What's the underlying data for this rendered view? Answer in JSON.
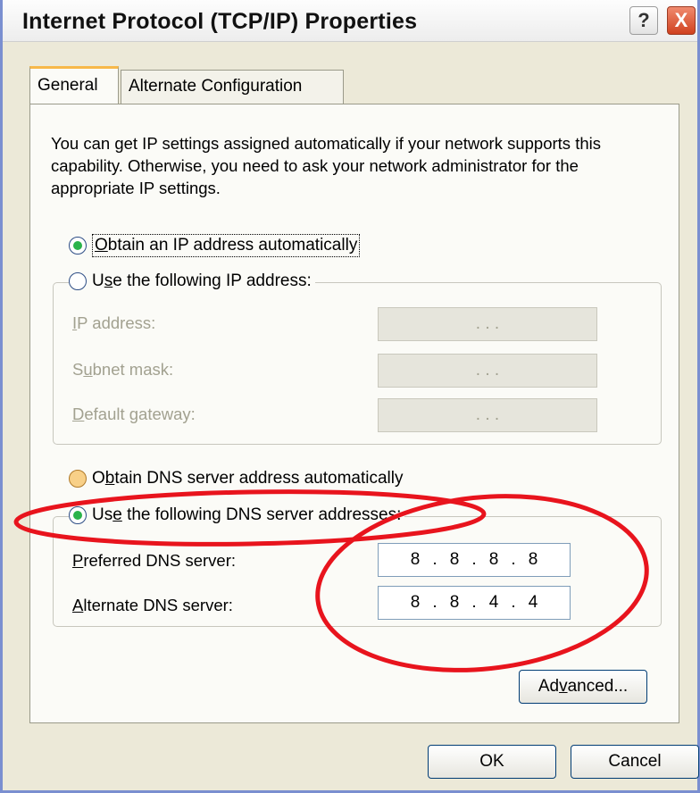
{
  "window": {
    "title": "Internet Protocol (TCP/IP) Properties",
    "help_glyph": "?",
    "close_glyph": "X"
  },
  "tabs": [
    {
      "label": "General",
      "selected": true
    },
    {
      "label": "Alternate Configuration",
      "selected": false
    }
  ],
  "intro_text": "You can get IP settings assigned automatically if your network supports this capability. Otherwise, you need to ask your network administrator for the appropriate IP settings.",
  "ip_section": {
    "auto_option": {
      "pre": "",
      "key": "O",
      "post": "btain an IP address automatically",
      "checked": true
    },
    "manual_option": {
      "pre": "U",
      "key": "s",
      "post": "e the following IP address:",
      "checked": false
    },
    "fields": [
      {
        "pre": "",
        "key": "I",
        "post": "P address:",
        "value": ". . ."
      },
      {
        "pre": "S",
        "key": "u",
        "post": "bnet mask:",
        "value": ". . ."
      },
      {
        "pre": "",
        "key": "D",
        "post": "efault gateway:",
        "value": ". . ."
      }
    ]
  },
  "dns_section": {
    "auto_option": {
      "pre": "O",
      "key": "b",
      "post": "tain DNS server address automatically",
      "checked": false
    },
    "manual_option": {
      "pre": "Us",
      "key": "e",
      "post": " the following DNS server addresses:",
      "checked": true
    },
    "preferred": {
      "pre": "",
      "key": "P",
      "post": "referred DNS server:",
      "octets": [
        "8",
        "8",
        "8",
        "8"
      ]
    },
    "alternate": {
      "pre": "",
      "key": "A",
      "post": "lternate DNS server:",
      "octets": [
        "8",
        "8",
        "4",
        "4"
      ]
    }
  },
  "buttons": {
    "advanced": {
      "pre": "Ad",
      "key": "v",
      "post": "anced..."
    },
    "ok": "OK",
    "cancel": "Cancel"
  },
  "colors": {
    "annotation": "#e8141d",
    "radio_checked": "#2ab34a",
    "tab_highlight": "#f7b84a",
    "close_button": "#d0411f"
  }
}
